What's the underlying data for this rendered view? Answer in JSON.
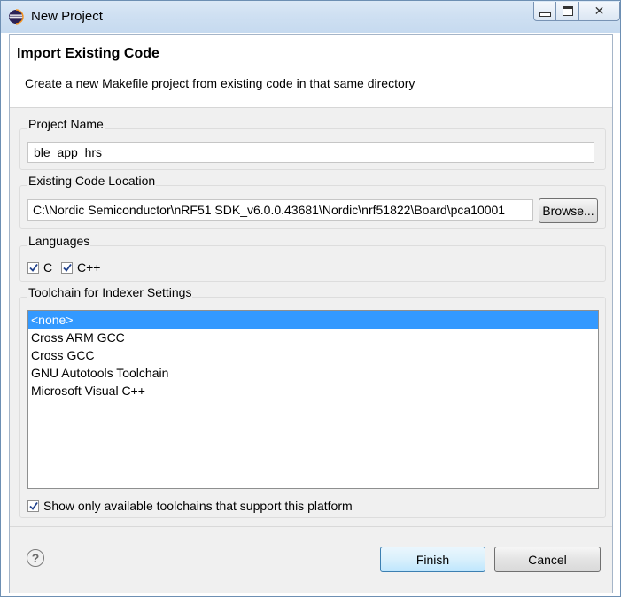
{
  "window": {
    "title": "New Project",
    "icon": "eclipse-icon",
    "controls": {
      "minimize": "minimize-icon",
      "maximize": "maximize-icon",
      "close": "close-icon"
    }
  },
  "banner": {
    "title": "Import Existing Code",
    "description": "Create a new Makefile project from existing code in that same directory"
  },
  "project_name": {
    "label": "Project Name",
    "value": "ble_app_hrs"
  },
  "code_location": {
    "label": "Existing Code Location",
    "value": "C:\\Nordic Semiconductor\\nRF51 SDK_v6.0.0.43681\\Nordic\\nrf51822\\Board\\pca10001",
    "browse_label": "Browse..."
  },
  "languages": {
    "label": "Languages",
    "options": [
      {
        "label": "C",
        "checked": true
      },
      {
        "label": "C++",
        "checked": true
      }
    ]
  },
  "toolchain": {
    "label": "Toolchain for Indexer Settings",
    "items": [
      "<none>",
      "Cross ARM GCC",
      "Cross GCC",
      "GNU Autotools Toolchain",
      "Microsoft Visual C++"
    ],
    "selected_index": 0,
    "show_only_label": "Show only available toolchains that support this platform",
    "show_only_checked": true
  },
  "footer": {
    "help_icon": "help-icon",
    "finish_label": "Finish",
    "cancel_label": "Cancel"
  },
  "colors": {
    "selection": "#3399ff",
    "titlebar": "#cfe0f2",
    "dialog_bg": "#f0f0f0"
  }
}
